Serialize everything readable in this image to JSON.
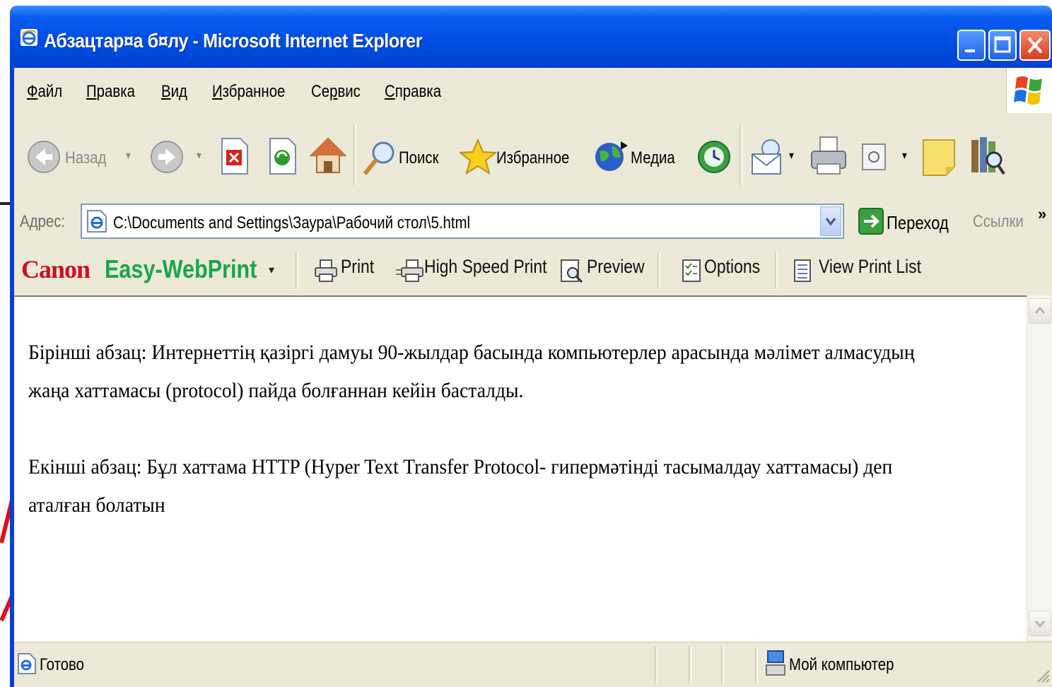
{
  "window": {
    "title": "Абзацтар¤а б¤лу - Microsoft Internet Explorer"
  },
  "menu": {
    "items": [
      {
        "label": "Файл",
        "underline": "Ф"
      },
      {
        "label": "Правка",
        "underline": "П"
      },
      {
        "label": "Вид",
        "underline": "В"
      },
      {
        "label": "Избранное",
        "underline": "И"
      },
      {
        "label": "Сервис",
        "underline": "р"
      },
      {
        "label": "Справка",
        "underline": "С"
      }
    ]
  },
  "toolbar": {
    "back_label": "Назад",
    "search_label": "Поиск",
    "favorites_label": "Избранное",
    "media_label": "Медиа"
  },
  "address": {
    "label": "Адрес:",
    "value": "C:\\Documents and Settings\\Заура\\Рабочий стол\\5.html",
    "go_label": "Переход",
    "links_label": "Ссылки",
    "more": "»"
  },
  "canon": {
    "brand": "Canon",
    "product": "Easy-WebPrint",
    "print_label": "Print",
    "high_speed_label": "High Speed Print",
    "preview_label": "Preview",
    "options_label": "Options",
    "view_list_label": "View Print List"
  },
  "content": {
    "paragraph1": "Бірінші абзац: Интернеттің қазіргі дамуы 90-жылдар басында компьютерлер арасында мәлімет алмасудың жаңа хаттамасы (protocol) пайда болғаннан кейін басталды.",
    "paragraph2": "Екінші абзац: Бұл хаттама HTTP (Hyper Text Transfer Protocol- гипермәтінді тасымалдау хаттамасы) деп аталған болатын"
  },
  "status": {
    "text": "Готово",
    "zone": "Мой компьютер"
  },
  "colors": {
    "titlebar": "#0050e6",
    "chrome": "#ece9d8",
    "canon_red": "#cc1020",
    "easy_green": "#1aa64a",
    "arrow": "#e01010"
  }
}
